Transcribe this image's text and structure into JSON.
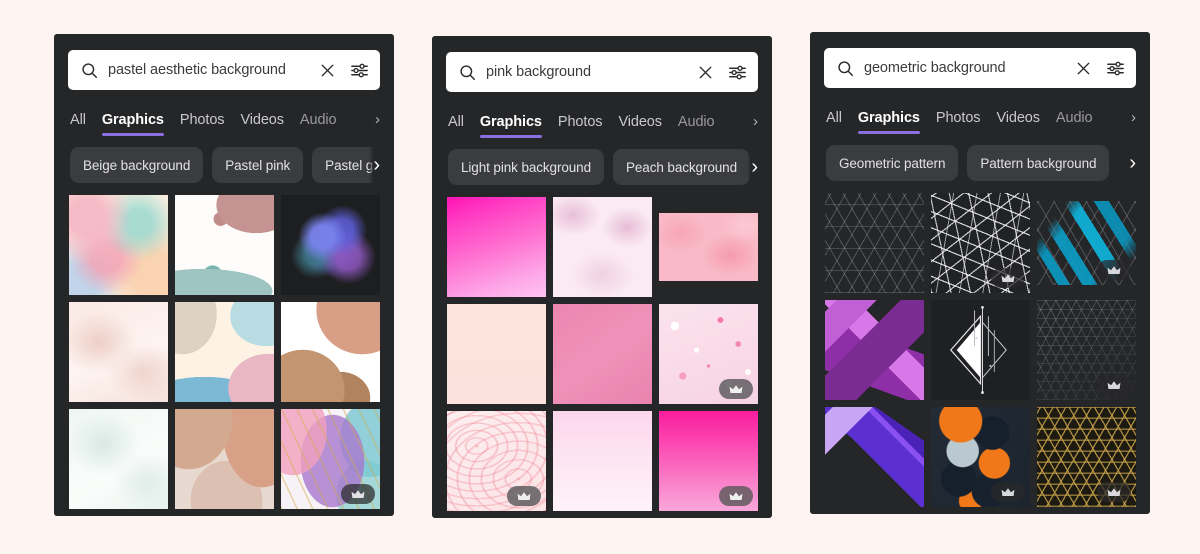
{
  "page": {
    "background_color": "#fdf3f0",
    "panel_background": "#252628",
    "accent_color": "#8b6fe0"
  },
  "icons": {
    "search": "search-icon",
    "clear": "close-icon",
    "filter": "sliders-filter-icon",
    "chevron_right": "chevron-right-icon",
    "premium": "crown-icon"
  },
  "panels": [
    {
      "id": "panel-pastel",
      "search": {
        "value": "pastel aesthetic background",
        "placeholder": "Search"
      },
      "tabs": [
        {
          "label": "All",
          "active": false,
          "faded": false
        },
        {
          "label": "Graphics",
          "active": true,
          "faded": false
        },
        {
          "label": "Photos",
          "active": false,
          "faded": false
        },
        {
          "label": "Videos",
          "active": false,
          "faded": false
        },
        {
          "label": "Audio",
          "active": false,
          "faded": true
        }
      ],
      "tabs_overflow": "›",
      "chips": [
        {
          "label": "Beige background"
        },
        {
          "label": "Pastel pink"
        },
        {
          "label": "Pastel g"
        }
      ],
      "chips_overflow": "›",
      "results": [
        {
          "name": "pastel-watercolor-blobs",
          "premium": false
        },
        {
          "name": "white-abstract-shapes",
          "premium": false
        },
        {
          "name": "dark-blue-smoke-cloud",
          "premium": false
        },
        {
          "name": "blush-marble-texture",
          "premium": false
        },
        {
          "name": "cream-organic-shapes",
          "premium": false
        },
        {
          "name": "terracotta-leaf-arch",
          "premium": false
        },
        {
          "name": "mint-marble-texture",
          "premium": false
        },
        {
          "name": "clay-tone-shapes",
          "premium": false
        },
        {
          "name": "gold-alcohol-ink",
          "premium": true
        }
      ]
    },
    {
      "id": "panel-pink",
      "search": {
        "value": "pink background",
        "placeholder": "Search"
      },
      "tabs": [
        {
          "label": "All",
          "active": false,
          "faded": false
        },
        {
          "label": "Graphics",
          "active": true,
          "faded": false
        },
        {
          "label": "Photos",
          "active": false,
          "faded": false
        },
        {
          "label": "Videos",
          "active": false,
          "faded": false
        },
        {
          "label": "Audio",
          "active": false,
          "faded": true
        }
      ],
      "tabs_overflow": "›",
      "chips": [
        {
          "label": "Light pink background"
        },
        {
          "label": "Peach background"
        }
      ],
      "chips_overflow": "›",
      "results": [
        {
          "name": "magenta-pink-gradient",
          "premium": false
        },
        {
          "name": "soft-pink-clouds",
          "premium": false
        },
        {
          "name": "pink-watercolor-wash",
          "premium": false
        },
        {
          "name": "pale-blush-solid",
          "premium": false
        },
        {
          "name": "rose-pink-gradient",
          "premium": false
        },
        {
          "name": "pink-confetti-dots",
          "premium": true
        },
        {
          "name": "pink-ink-swirl",
          "premium": true
        },
        {
          "name": "light-pink-gradient",
          "premium": false
        },
        {
          "name": "hot-pink-gradient",
          "premium": true
        }
      ]
    },
    {
      "id": "panel-geometric",
      "search": {
        "value": "geometric background",
        "placeholder": "Search"
      },
      "tabs": [
        {
          "label": "All",
          "active": false,
          "faded": false
        },
        {
          "label": "Graphics",
          "active": true,
          "faded": false
        },
        {
          "label": "Photos",
          "active": false,
          "faded": false
        },
        {
          "label": "Videos",
          "active": false,
          "faded": false
        },
        {
          "label": "Audio",
          "active": false,
          "faded": true
        }
      ],
      "tabs_overflow": "›",
      "chips": [
        {
          "label": "Geometric pattern"
        },
        {
          "label": "Pattern background"
        }
      ],
      "chips_overflow": "›",
      "results": [
        {
          "name": "hexagon-outline-grid",
          "premium": false
        },
        {
          "name": "white-triangle-mesh",
          "premium": true
        },
        {
          "name": "teal-isometric-cubes",
          "premium": true
        },
        {
          "name": "purple-triangle-shapes",
          "premium": false
        },
        {
          "name": "white-line-triangle",
          "premium": false
        },
        {
          "name": "faint-triangle-lattice",
          "premium": true
        },
        {
          "name": "violet-arrow-shapes",
          "premium": false
        },
        {
          "name": "orange-hexagon-cluster",
          "premium": true
        },
        {
          "name": "gold-maze-pattern",
          "premium": true
        }
      ]
    }
  ]
}
